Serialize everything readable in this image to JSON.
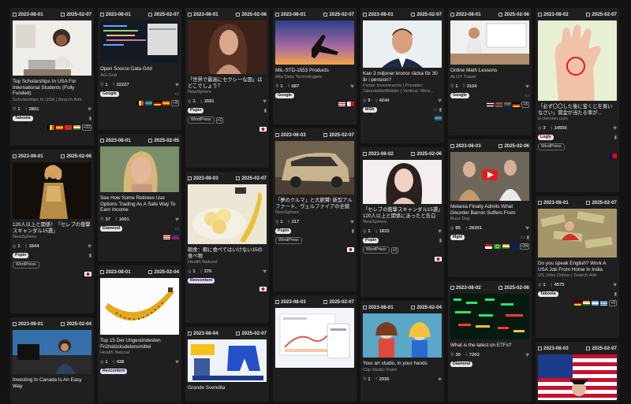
{
  "cards": [
    {
      "id": "c1",
      "start": "2023-08-01",
      "end": "2025-02-07",
      "title": "Top Scholarships In USA For International Students (Fully Funded)",
      "sub": "Scholarships In USA | Search Ads",
      "s1": "1",
      "s2": "2801",
      "badges": [
        "Taboola"
      ],
      "flags": [
        "be",
        "es",
        "cn",
        "in"
      ],
      "more": "+33"
    },
    {
      "id": "c2",
      "start": "2023-08-01",
      "end": "2025-02-06",
      "title": "120人以上と関係！「セレブの衝撃スキャンダル15選」",
      "sub": "NewSphere",
      "s1": "1",
      "s2": "1644",
      "badges": [
        "Popin"
      ],
      "network": "WordPress",
      "flags": [
        "jp"
      ]
    },
    {
      "id": "c3",
      "start": "2023-08-01",
      "end": "2025-02-04",
      "title": "Investing In Canada Is An Easy Way",
      "sub": ""
    },
    {
      "id": "c4",
      "start": "2023-08-01",
      "end": "2025-02-07",
      "title": "Open Source Data Grid",
      "sub": "AG-Grid",
      "s1": "1",
      "s2": "22227",
      "badges": [
        "Google"
      ],
      "flags": [
        "be",
        "se",
        "de",
        "es"
      ],
      "more": "+8"
    },
    {
      "id": "c5",
      "start": "2023-08-01",
      "end": "2025-02-05",
      "title": "See How Some Retirees Use Options Trading As A Safe Way To Earn Income",
      "sub": "",
      "s1": "37",
      "s2": "1601",
      "badges": [
        "Diamond"
      ],
      "flags": [
        "us",
        "ph"
      ]
    },
    {
      "id": "c6",
      "start": "2023-08-01",
      "end": "2025-02-04",
      "title": "Top 15 Der Ungesündesten Frühstücksdelensmittel",
      "sub": "Health Natural",
      "s1": "1",
      "s2": "438",
      "badges": [
        "Revcontent"
      ]
    },
    {
      "id": "c7",
      "start": "2023-08-01",
      "end": "2025-02-06",
      "title": "「世界で最高にセクシーな国」はどこでしょう？",
      "sub": "NewSphere",
      "s1": "1",
      "s2": "1581",
      "badges": [
        "Popin"
      ],
      "network": "WordPress",
      "more": "+1",
      "flags": [
        "jp"
      ]
    },
    {
      "id": "c8",
      "start": "2023-08-03",
      "end": "2025-02-07",
      "title": "朝食：朝に食べてはいけない15の食べ物",
      "sub": "Health Natural",
      "s1": "1",
      "s2": "376",
      "badges": [
        "Revcontent"
      ],
      "flags": [
        "jp"
      ]
    },
    {
      "id": "c9",
      "start": "2023-08-04",
      "end": "2025-02-07",
      "title": "Grande Svendita",
      "sub": ""
    },
    {
      "id": "c10",
      "start": "2023-08-01",
      "end": "2025-02-07",
      "title": "MIL-STD-1553 Products",
      "sub": "Alta Data Technologies",
      "s1": "1",
      "s2": "687",
      "badges": [
        "Google"
      ],
      "flags": [
        "us",
        "pa"
      ]
    },
    {
      "id": "c11",
      "start": "2023-08-03",
      "end": "2025-02-07",
      "title": "「夢のクルマ」と大絶賛! 新型アルファード、ヴェルファイアの全貌",
      "sub": "NewSphere",
      "s1": "1",
      "s2": "217",
      "badges": [
        "Popin"
      ],
      "network": "WordPress",
      "flags": [
        "jp"
      ]
    },
    {
      "id": "c12",
      "start": "2023-08-03",
      "end": "2025-02-07",
      "title": "",
      "sub": ""
    },
    {
      "id": "c13",
      "start": "2023-08-01",
      "end": "2025-02-07",
      "title": "Kan 3 miljoner kronor räcka för 30 år i pension?",
      "sub": "Fisher Investments | Provider: TaboolaNetBidder | Vertical: Wea...",
      "s1": "9",
      "s2": "4244",
      "badges": [
        "MSN"
      ],
      "flags": [
        "se"
      ]
    },
    {
      "id": "c14",
      "start": "2023-08-02",
      "end": "2025-02-06",
      "title": "「セレブの衝撃スキャンダル15選」120人以上と関係にあったと告白",
      "sub": "NewSphere",
      "s1": "1",
      "s2": "1833",
      "badges": [
        "Popin"
      ],
      "network": "WordPress",
      "more": "+1",
      "flags": [
        "jp"
      ]
    },
    {
      "id": "c15",
      "start": "2023-08-01",
      "end": "2025-02-04",
      "title": "Your art studio, in your hands",
      "sub": "Clip Studio Paint",
      "s1": "1",
      "s2": "2936",
      "badges": [
        "Diamond"
      ],
      "flags": [
        "us",
        "gb",
        "ie",
        "fr"
      ],
      "more": "+2"
    },
    {
      "id": "c16",
      "start": "2023-08-01",
      "end": "2025-02-06",
      "title": "Online Math Lessons",
      "sub": "ALOT Travel",
      "s1": "1",
      "s2": "3104",
      "badges": [
        "Google"
      ],
      "flags": [
        "th",
        "sr",
        "za",
        "de"
      ],
      "more": "+5"
    },
    {
      "id": "c17",
      "start": "2023-08-03",
      "end": "2025-02-06",
      "title": "Melania Finally Admits What Disorder Barron Suffers From",
      "sub": "Buzz Day",
      "s1": "85",
      "s2": "28391",
      "badges": [
        "Mgid"
      ],
      "flags": [
        "id",
        "br",
        "in",
        "gb"
      ],
      "more": "+34"
    },
    {
      "id": "c18",
      "start": "2023-08-02",
      "end": "2025-02-06",
      "title": "What is the latest on ETFs?",
      "sub": "",
      "s1": "30",
      "s2": "7203",
      "badges": [
        "Diamond"
      ]
    },
    {
      "id": "c19",
      "start": "2023-08-02",
      "end": "2025-02-07",
      "title": "「必ず〇〇した後に宝くじを買いなさい」賞金が当たる率が...",
      "sub": "b-checker.com",
      "s1": "3",
      "s2": "14555",
      "badges": [
        "Logly"
      ],
      "network": "WordPress",
      "flags": [
        "tw"
      ]
    },
    {
      "id": "c20",
      "start": "2023-08-01",
      "end": "2025-02-07",
      "title": "Do you speak English? Work A USA Job From Home In India",
      "sub": "US Jobs Online | Search Ads",
      "s1": "1",
      "s2": "4575",
      "badges": [
        "Taboola"
      ],
      "flags": [
        "de",
        "in",
        "ar",
        "gr"
      ],
      "more": "+6"
    },
    {
      "id": "c21",
      "start": "2023-08-03",
      "end": "2025-02-07",
      "title": "",
      "sub": ""
    }
  ]
}
